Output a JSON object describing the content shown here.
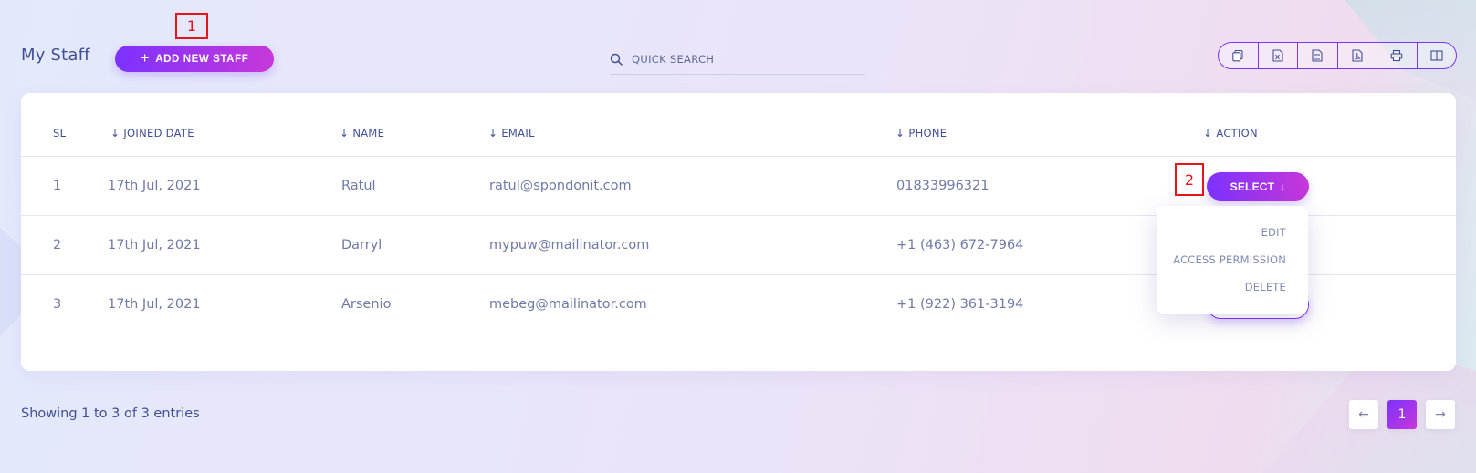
{
  "header": {
    "title": "My Staff",
    "add_button_label": "ADD NEW STAFF",
    "search_placeholder": "QUICK SEARCH"
  },
  "markers": {
    "m1": "1",
    "m2": "2"
  },
  "export_buttons": [
    {
      "icon": "copy-icon"
    },
    {
      "icon": "excel-icon"
    },
    {
      "icon": "csv-icon"
    },
    {
      "icon": "pdf-icon"
    },
    {
      "icon": "print-icon"
    },
    {
      "icon": "columns-icon"
    }
  ],
  "table": {
    "columns": [
      "SL",
      "JOINED DATE",
      "NAME",
      "EMAIL",
      "PHONE",
      "ACTION"
    ],
    "rows": [
      {
        "sl": "1",
        "joined": "17th Jul, 2021",
        "name": "Ratul",
        "email": "ratul@spondonit.com",
        "phone": "01833996321"
      },
      {
        "sl": "2",
        "joined": "17th Jul, 2021",
        "name": "Darryl",
        "email": "mypuw@mailinator.com",
        "phone": "+1 (463) 672-7964"
      },
      {
        "sl": "3",
        "joined": "17th Jul, 2021",
        "name": "Arsenio",
        "email": "mebeg@mailinator.com",
        "phone": "+1 (922) 361-3194"
      }
    ],
    "select_label": "SELECT"
  },
  "dropdown": {
    "items": [
      "EDIT",
      "ACCESS PERMISSION",
      "DELETE"
    ]
  },
  "footer": {
    "entries_text": "Showing 1 to 3 of 3 entries",
    "current_page": "1"
  },
  "colors": {
    "accent_start": "#7c32ff",
    "accent_end": "#c738d8",
    "text": "#415094"
  }
}
